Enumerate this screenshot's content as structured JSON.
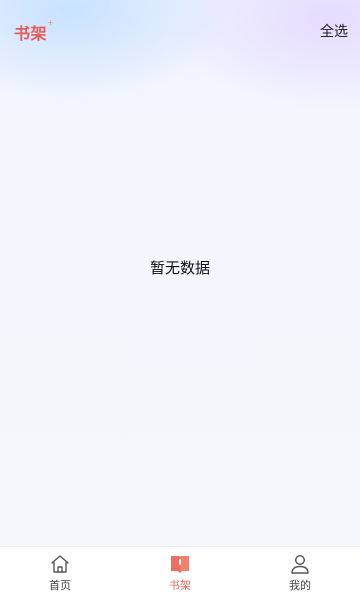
{
  "header": {
    "title": "书架",
    "sparkle": "+",
    "select_all_label": "全选"
  },
  "main": {
    "empty_text": "暂无数据"
  },
  "tabbar": {
    "tabs": [
      {
        "label": "首页",
        "icon": "home-icon",
        "active": false
      },
      {
        "label": "书架",
        "icon": "bookshelf-icon",
        "active": true
      },
      {
        "label": "我的",
        "icon": "user-icon",
        "active": false
      }
    ]
  },
  "colors": {
    "accent": "#e85a56",
    "tab_active": "#e86a5e",
    "background": "#f5f7fc"
  }
}
